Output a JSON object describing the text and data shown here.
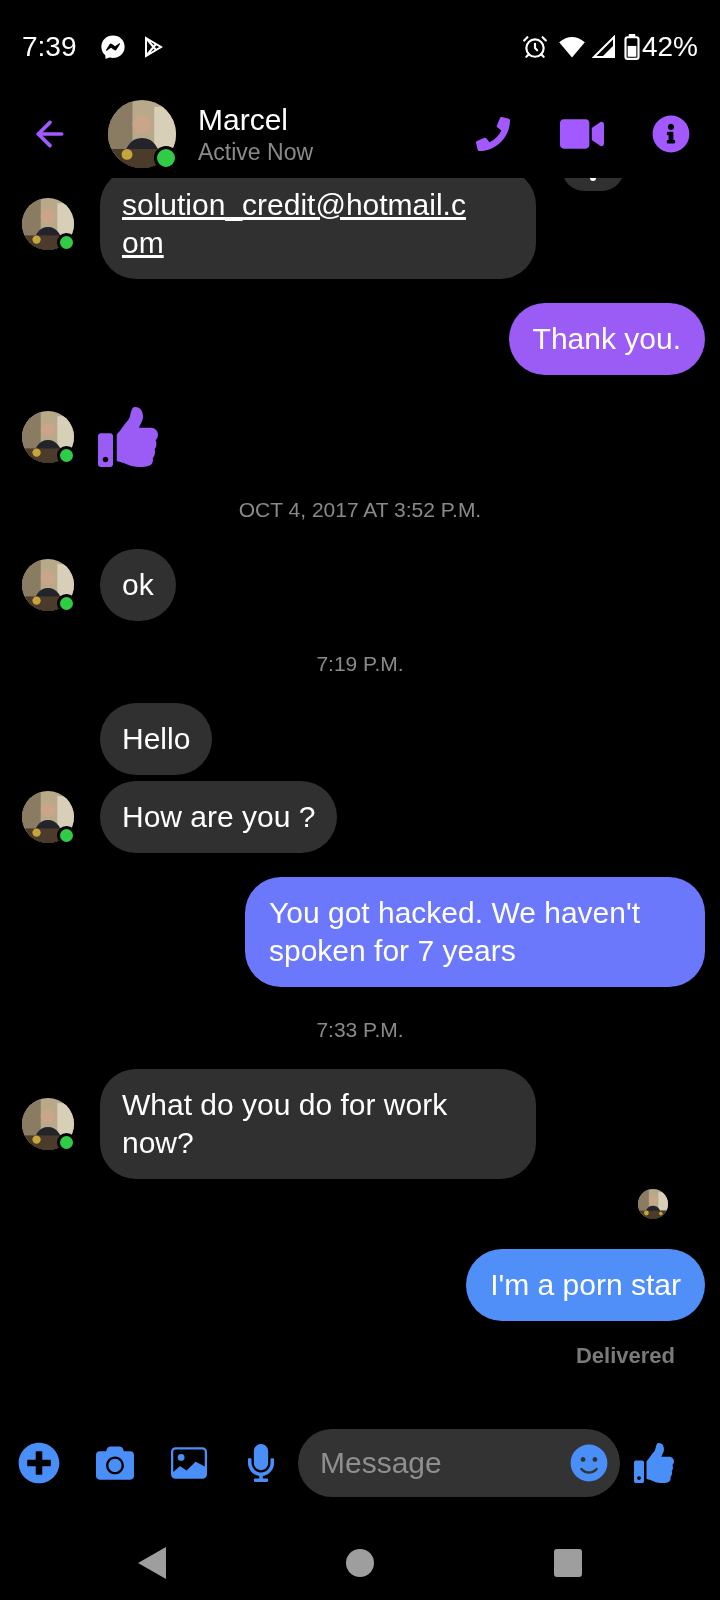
{
  "status_bar": {
    "time": "7:39",
    "battery": "42%"
  },
  "contact": {
    "name": "Marcel",
    "status": "Active Now",
    "online": true
  },
  "messages": [
    {
      "kind": "incoming",
      "text": "solution_credit@hotmail.com",
      "link": true
    },
    {
      "kind": "outgoing",
      "text": "Thank you.",
      "color": "#9b5cf6"
    },
    {
      "kind": "like"
    },
    {
      "kind": "timestamp",
      "text": "OCT 4, 2017 AT 3:52 P.M."
    },
    {
      "kind": "incoming",
      "text": "ok",
      "link": false
    },
    {
      "kind": "timestamp",
      "text": "7:19 P.M."
    },
    {
      "kind": "incoming",
      "text": "Hello",
      "link": false
    },
    {
      "kind": "incoming",
      "text": "How are you ?",
      "link": false
    },
    {
      "kind": "outgoing",
      "text": "You got hacked. We haven't spoken for 7 years",
      "color": "#6b78fc"
    },
    {
      "kind": "timestamp",
      "text": "7:33 P.M."
    },
    {
      "kind": "incoming",
      "text": "What do you do for work now?",
      "link": false
    },
    {
      "kind": "seen"
    },
    {
      "kind": "outgoing",
      "text": "I'm a porn star",
      "color": "#4f8ff7"
    },
    {
      "kind": "status",
      "text": "Delivered"
    }
  ],
  "composer": {
    "placeholder": "Message"
  }
}
